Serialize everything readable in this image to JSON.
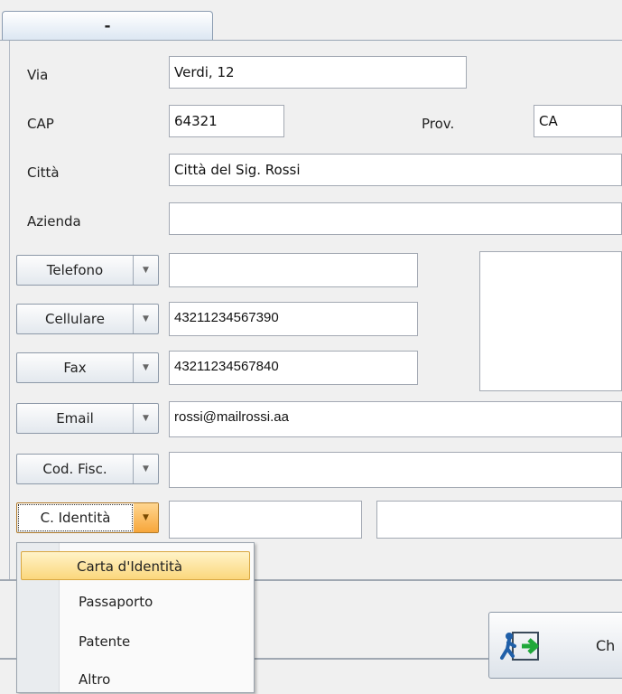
{
  "tab": {
    "label": "-"
  },
  "fields": {
    "via": {
      "label": "Via",
      "value": "Verdi, 12"
    },
    "cap": {
      "label": "CAP",
      "value": "64321"
    },
    "prov": {
      "label": "Prov.",
      "value": "CA"
    },
    "citta": {
      "label": "Città",
      "value": "Città del Sig. Rossi"
    },
    "azienda": {
      "label": "Azienda",
      "value": ""
    }
  },
  "contacts": [
    {
      "label": "Telefono",
      "value": ""
    },
    {
      "label": "Cellulare",
      "value": "43211234567390"
    },
    {
      "label": "Fax",
      "value": "43211234567840"
    },
    {
      "label": "Email",
      "value": "rossi@mailrossi.aa"
    },
    {
      "label": "Cod. Fisc.",
      "value": ""
    },
    {
      "label": "C. Identità",
      "value": "",
      "value2": ""
    }
  ],
  "dropdown_menu": {
    "items": [
      "Carta d'Identità",
      "Passaporto",
      "Patente",
      "Altro"
    ],
    "selected_index": 0
  },
  "bottom_button": {
    "label": "Ch",
    "icon": "exit-door-icon"
  },
  "colors": {
    "menu_highlight": "#fbd77c",
    "active_arrow": "#f7a63a"
  }
}
